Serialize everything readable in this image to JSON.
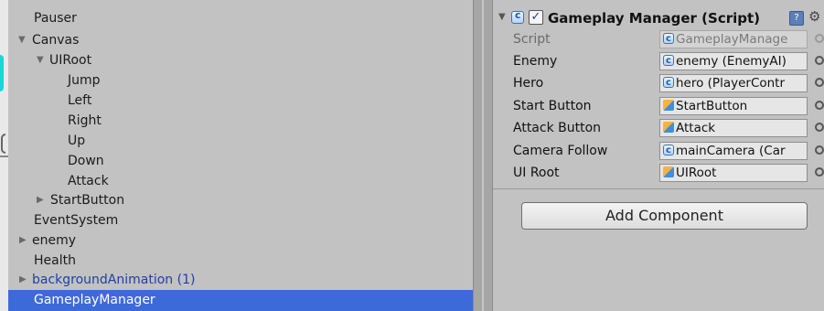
{
  "hierarchy": {
    "rows": [
      {
        "label": "Pauser",
        "arrow": ""
      },
      {
        "label": "Canvas",
        "arrow": "▼"
      },
      {
        "label": "UIRoot",
        "arrow": "▼"
      },
      {
        "label": "Jump",
        "arrow": ""
      },
      {
        "label": "Left",
        "arrow": ""
      },
      {
        "label": "Right",
        "arrow": ""
      },
      {
        "label": "Up",
        "arrow": ""
      },
      {
        "label": "Down",
        "arrow": ""
      },
      {
        "label": "Attack",
        "arrow": ""
      },
      {
        "label": "StartButton",
        "arrow": "▶"
      },
      {
        "label": "EventSystem",
        "arrow": ""
      },
      {
        "label": "enemy",
        "arrow": "▶"
      },
      {
        "label": "Health",
        "arrow": ""
      },
      {
        "label": "backgroundAnimation (1)",
        "arrow": "▶"
      },
      {
        "label": "GameplayManager",
        "arrow": ""
      }
    ],
    "selected": "GameplayManager"
  },
  "inspector": {
    "component": {
      "title": "Gameplay Manager (Script)",
      "enabled_check": "✓",
      "help": "?",
      "gear": "⚙"
    },
    "properties": [
      {
        "label": "Script",
        "value": "GameplayManage",
        "kind": "script"
      },
      {
        "label": "Enemy",
        "value": "enemy (EnemyAI)",
        "kind": "script"
      },
      {
        "label": "Hero",
        "value": "hero (PlayerContr",
        "kind": "script"
      },
      {
        "label": "Start Button",
        "value": "StartButton",
        "kind": "prefab"
      },
      {
        "label": "Attack Button",
        "value": "Attack",
        "kind": "prefab"
      },
      {
        "label": "Camera Follow",
        "value": "mainCamera (Car",
        "kind": "script"
      },
      {
        "label": "UI Root",
        "value": "UIRoot",
        "kind": "prefab"
      }
    ],
    "add_component_label": "Add Component"
  }
}
